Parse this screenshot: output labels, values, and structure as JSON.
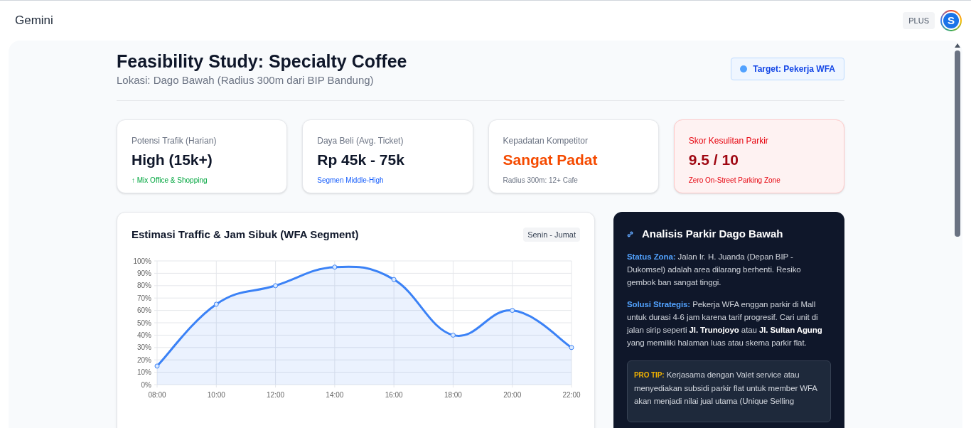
{
  "app": {
    "title": "Gemini",
    "plan": "PLUS",
    "avatar": "S"
  },
  "header": {
    "title": "Feasibility Study: Specialty Coffee",
    "subtitle": "Lokasi: Dago Bawah (Radius 300m dari BIP Bandung)",
    "badge": "Target: Pekerja WFA"
  },
  "metrics": [
    {
      "label": "Potensi Trafik (Harian)",
      "value": "High (15k+)",
      "note": "↑ Mix Office & Shopping",
      "kind": "positive"
    },
    {
      "label": "Daya Beli (Avg. Ticket)",
      "value": "Rp 45k - 75k",
      "note": "Segmen Middle-High",
      "kind": "info"
    },
    {
      "label": "Kepadatan Kompetitor",
      "value": "Sangat Padat",
      "note": "Radius 300m: 12+ Cafe",
      "kind": "warning"
    },
    {
      "label": "Skor Kesulitan Parkir",
      "value": "9.5 / 10",
      "note": "Zero On-Street Parking Zone",
      "kind": "danger"
    }
  ],
  "chart_card": {
    "title": "Estimasi Traffic & Jam Sibuk (WFA Segment)",
    "badge": "Senin - Jumat",
    "chart_data": {
      "type": "area",
      "categories": [
        "08:00",
        "10:00",
        "12:00",
        "14:00",
        "16:00",
        "18:00",
        "20:00",
        "22:00"
      ],
      "series": [
        {
          "color": "#3b82f6",
          "values": [
            15,
            65,
            80,
            95,
            85,
            40,
            60,
            30
          ]
        }
      ],
      "grid": true,
      "ylim": [
        0,
        100
      ],
      "yticks": [
        {
          "value": 0,
          "label": "0%"
        },
        {
          "value": 10,
          "label": "10%"
        },
        {
          "value": 20,
          "label": "20%"
        },
        {
          "value": 30,
          "label": "30%"
        },
        {
          "value": 40,
          "label": "40%"
        },
        {
          "value": 50,
          "label": "50%"
        },
        {
          "value": 60,
          "label": "60%"
        },
        {
          "value": 70,
          "label": "70%"
        },
        {
          "value": 80,
          "label": "80%"
        },
        {
          "value": 90,
          "label": "90%"
        },
        {
          "value": 100,
          "label": "100%"
        }
      ]
    }
  },
  "analysis": {
    "title": "Analisis Parkir Dago Bawah",
    "paragraphs": [
      {
        "label": "Status Zona:",
        "text": "Jalan Ir. H. Juanda (Depan BIP - Dukomsel) adalah area dilarang berhenti. Resiko gembok ban sangat tinggi.",
        "kind": "plain"
      },
      {
        "label": "Solusi Strategis:",
        "text": "Pekerja WFA enggan parkir di Mall untuk durasi 4-6 jam karena tarif progresif. Cari unit di jalan sirip seperti **Jl. Trunojoyo** atau **Jl. Sultan Agung** yang memiliki halaman luas atau skema parkir flat.",
        "kind": "plain"
      },
      {
        "label": "PRO TIP:",
        "text": "Kerjasama dengan Valet service atau menyediakan subsidi parkir flat untuk member WFA akan menjadi nilai jual utama (Unique Selling",
        "kind": "tip"
      }
    ]
  }
}
